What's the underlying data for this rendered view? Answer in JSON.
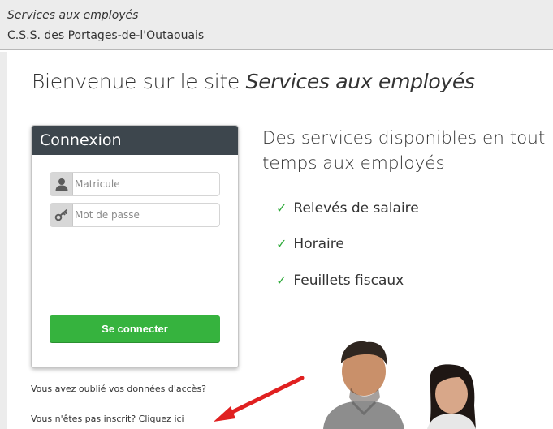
{
  "header": {
    "app_name": "Services aux employés",
    "organization": "C.S.S. des Portages-de-l'Outaouais"
  },
  "welcome": {
    "prefix": "Bienvenue sur le site",
    "site_name": "Services aux employés"
  },
  "login": {
    "title": "Connexion",
    "username_placeholder": "Matricule",
    "password_placeholder": "Mot de passe",
    "submit_label": "Se connecter"
  },
  "links": {
    "forgot": "Vous avez oublié vos données d'accès?",
    "register": "Vous n'êtes pas inscrit? Cliquez ici"
  },
  "promo": {
    "title": "Des services disponibles en tout temps aux employés",
    "features": [
      "Relevés de salaire",
      "Horaire",
      "Feuillets fiscaux"
    ]
  },
  "colors": {
    "login_header": "#3d464d",
    "button": "#36b33e",
    "check": "#2eaa3a",
    "arrow": "#e02020"
  }
}
